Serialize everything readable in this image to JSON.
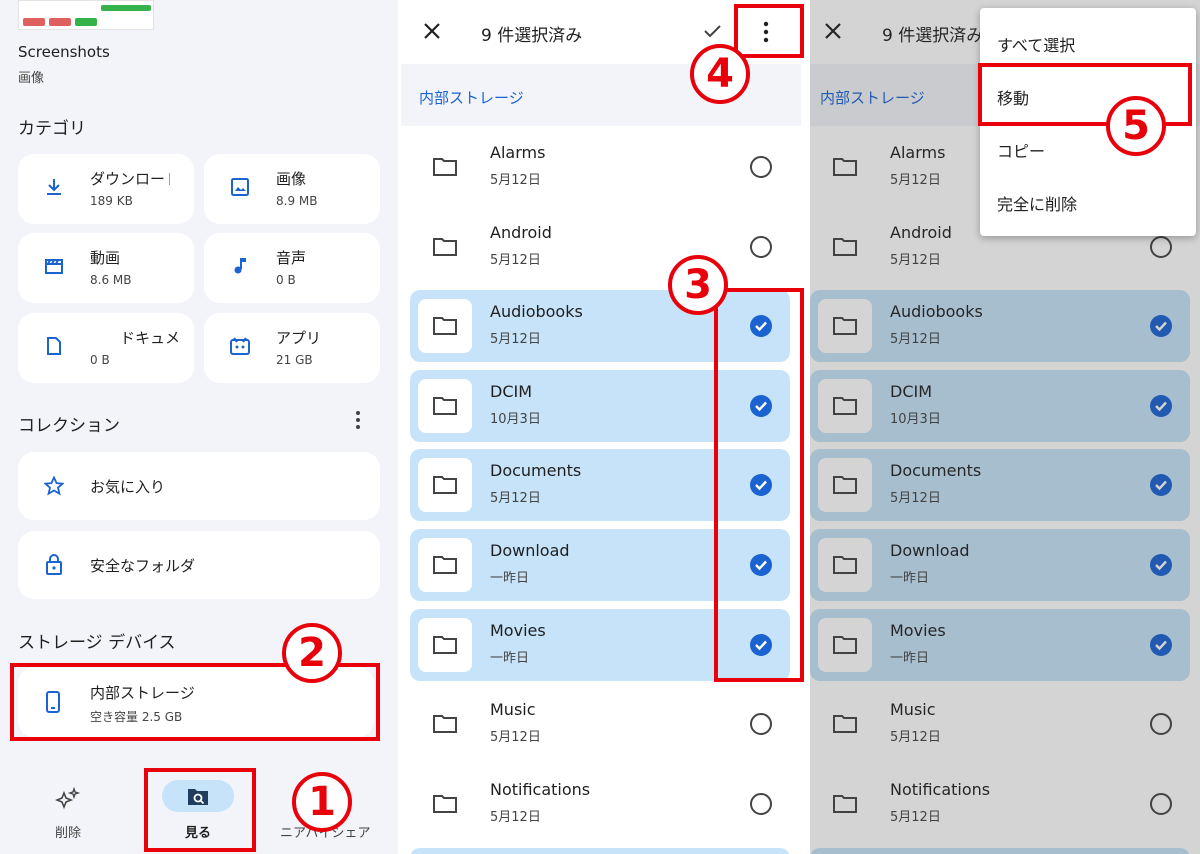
{
  "left": {
    "thumb_caption": "Screenshots",
    "thumb_sub": "画像",
    "categories_title": "カテゴリ",
    "categories": [
      {
        "icon": "download-icon",
        "name": "ダウンロード",
        "size": "189 KB"
      },
      {
        "icon": "image-icon",
        "name": "画像",
        "size": "8.9 MB"
      },
      {
        "icon": "video-icon",
        "name": "動画",
        "size": "8.6 MB"
      },
      {
        "icon": "music-icon",
        "name": "音声",
        "size": "0 B"
      },
      {
        "icon": "document-icon",
        "name": "ドキュメント",
        "size": "0 B"
      },
      {
        "icon": "apps-icon",
        "name": "アプリ",
        "size": "21 GB"
      }
    ],
    "collections_title": "コレクション",
    "collections": [
      {
        "icon": "star-icon",
        "label": "お気に入り"
      },
      {
        "icon": "lock-icon",
        "label": "安全なフォルダ"
      }
    ],
    "storage_title": "ストレージ デバイス",
    "storage": {
      "name": "内部ストレージ",
      "free": "空き容量 2.5 GB"
    },
    "nav": [
      {
        "icon": "sparkle-icon",
        "label": "削除"
      },
      {
        "icon": "browse-icon",
        "label": "見る"
      },
      {
        "icon": "share-icon",
        "label": "ニアバイシェア"
      }
    ]
  },
  "middle": {
    "selected_count": "9 件選択済み",
    "breadcrumb": "内部ストレージ",
    "folders": [
      {
        "name": "Alarms",
        "date": "5月12日",
        "selected": false
      },
      {
        "name": "Android",
        "date": "5月12日",
        "selected": false
      },
      {
        "name": "Audiobooks",
        "date": "5月12日",
        "selected": true
      },
      {
        "name": "DCIM",
        "date": "10月3日",
        "selected": true
      },
      {
        "name": "Documents",
        "date": "5月12日",
        "selected": true
      },
      {
        "name": "Download",
        "date": "一昨日",
        "selected": true
      },
      {
        "name": "Movies",
        "date": "一昨日",
        "selected": true
      },
      {
        "name": "Music",
        "date": "5月12日",
        "selected": false
      },
      {
        "name": "Notifications",
        "date": "5月12日",
        "selected": false
      }
    ]
  },
  "right": {
    "selected_count": "9 件選択済み",
    "breadcrumb": "内部ストレージ",
    "menu": [
      "すべて選択",
      "移動",
      "コピー",
      "完全に削除"
    ]
  },
  "annotations": [
    "1",
    "2",
    "3",
    "4",
    "5"
  ],
  "colors": {
    "accent": "#1a63d1",
    "highlight": "#e8000b",
    "selected_row": "#c6e3f9"
  }
}
